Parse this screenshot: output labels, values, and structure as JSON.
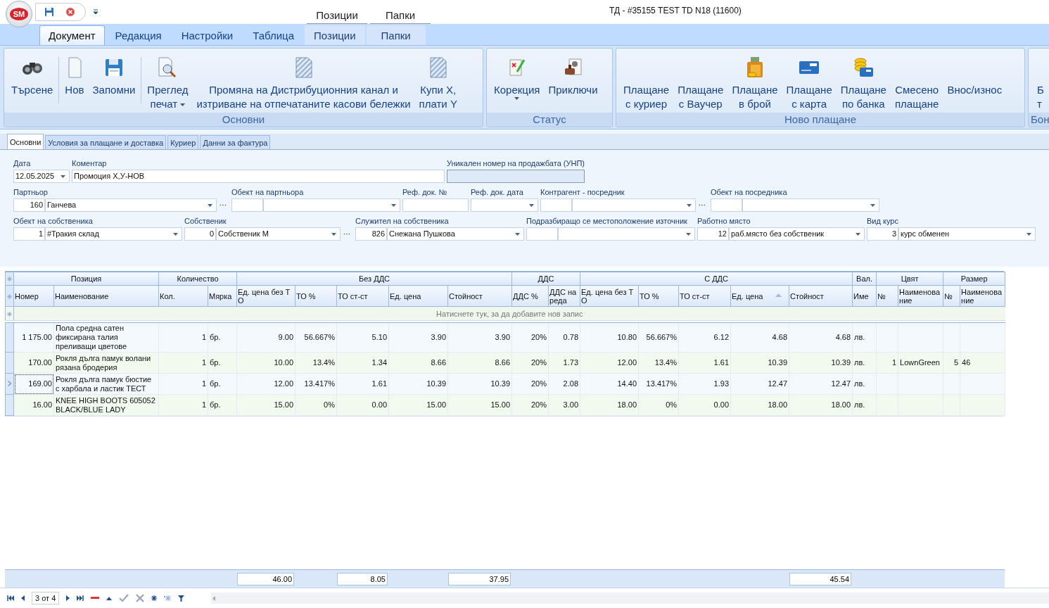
{
  "window": {
    "title": "ТД - #35155 TEST TD N18 (11600)"
  },
  "app_logo": {
    "text": "SM"
  },
  "contextual_groups": [
    {
      "label": "Позиции"
    },
    {
      "label": "Папки"
    }
  ],
  "ribbon_tabs": [
    {
      "label": "Документ",
      "selected": true,
      "contextual": false
    },
    {
      "label": "Редакция",
      "selected": false,
      "contextual": false
    },
    {
      "label": "Настройки",
      "selected": false,
      "contextual": false
    },
    {
      "label": "Таблица",
      "selected": false,
      "contextual": false
    },
    {
      "label": "Позиции",
      "selected": false,
      "contextual": true
    },
    {
      "label": "Папки",
      "selected": false,
      "contextual": true
    }
  ],
  "ribbon_groups": [
    {
      "label": "Основни",
      "buttons": [
        {
          "label": "Търсене",
          "dropdown": false
        },
        {
          "label": "Нов",
          "dropdown": false
        },
        {
          "label": "Запомни",
          "dropdown": false
        },
        {
          "label": "Преглед\nпечат",
          "dropdown": true
        },
        {
          "label": "Промяна на Дистрибуционния канал и\nизтриване на отпечатаните касови бележки",
          "dropdown": false
        },
        {
          "label": "Купи Х,\nплати Y",
          "dropdown": false
        }
      ]
    },
    {
      "label": "Статус",
      "buttons": [
        {
          "label": "Корекция",
          "dropdown": true
        },
        {
          "label": "Приключи",
          "dropdown": false
        }
      ]
    },
    {
      "label": "Ново плащане",
      "buttons": [
        {
          "label": "Плащане\nс куриер",
          "dropdown": false
        },
        {
          "label": "Плащане\nс Ваучер",
          "dropdown": false
        },
        {
          "label": "Плащане\nв брой",
          "dropdown": false
        },
        {
          "label": "Плащане\nс карта",
          "dropdown": false
        },
        {
          "label": "Плащане\nпо банка",
          "dropdown": false
        },
        {
          "label": "Смесено\nплащане",
          "dropdown": false
        },
        {
          "label": "Внос/износ",
          "dropdown": false
        }
      ]
    },
    {
      "label": "Бон",
      "buttons": [
        {
          "label": "Б\nт",
          "dropdown": false
        }
      ]
    }
  ],
  "form_tabs": [
    {
      "label": "Основни",
      "selected": true
    },
    {
      "label": "Условия за плащане и доставка",
      "selected": false
    },
    {
      "label": "Куриер",
      "selected": false
    },
    {
      "label": "Данни за фактура",
      "selected": false
    }
  ],
  "form_rows": [
    {
      "fields": [
        {
          "label": "Дата",
          "kind": "date",
          "value": "12.05.2025"
        },
        {
          "label": "Коментар",
          "kind": "text",
          "value": "Промоция Х,У-НОВ"
        },
        {
          "label": "Уникален номер на продажбата (УНП)",
          "kind": "readonly"
        }
      ]
    },
    {
      "fields": [
        {
          "label": "Партньор",
          "kind": "combo",
          "code": "160",
          "value": "Ганчева",
          "browse": true
        },
        {
          "label": "Обект на партньора",
          "kind": "combo",
          "browse": false
        },
        {
          "label": "Реф. док. №",
          "kind": "text"
        },
        {
          "label": "Реф. док. дата",
          "kind": "date"
        },
        {
          "label": "Контрагент - посредник",
          "kind": "combo",
          "browse": true
        },
        {
          "label": "Обект на посредника",
          "kind": "combo",
          "browse": false
        }
      ]
    },
    {
      "fields": [
        {
          "label": "Обект на собственика",
          "kind": "combo",
          "code": "1",
          "value": "#Тракия склад",
          "browse": false
        },
        {
          "label": "Собственик",
          "kind": "combo",
          "code": "0",
          "value": "Собственик М",
          "browse": true
        },
        {
          "label": "Служител на собственика",
          "kind": "combo",
          "code": "826",
          "value": "Снежана Пушкова",
          "browse": false
        },
        {
          "label": "Подразбиращо се местоположение източник",
          "kind": "combo",
          "browse": false
        },
        {
          "label": "Работно място",
          "kind": "combo",
          "code": "12",
          "value": "раб.място без собственик",
          "browse": false
        },
        {
          "label": "Вид курс",
          "kind": "combo",
          "code": "3",
          "value": "курс обменен",
          "browse": false
        }
      ]
    }
  ],
  "grid": {
    "column_groups": [
      {
        "label": "Позиция",
        "columns": [
          {
            "label": "Номер",
            "numeric": true
          },
          {
            "label": "Наименование",
            "numeric": false
          }
        ]
      },
      {
        "label": "Количество",
        "columns": [
          {
            "label": "Кол.",
            "numeric": true
          },
          {
            "label": "Мярка",
            "numeric": false
          }
        ]
      },
      {
        "label": "Без ДДС",
        "columns": [
          {
            "label": "Ед. цена без ТО",
            "numeric": true,
            "total": "46.00"
          },
          {
            "label": "ТО %",
            "numeric": true
          },
          {
            "label": "ТО ст-ст",
            "numeric": true,
            "total": "8.05"
          },
          {
            "label": "Ед. цена",
            "numeric": true
          },
          {
            "label": "Стойност",
            "numeric": true,
            "total": "37.95"
          }
        ]
      },
      {
        "label": "ДДС",
        "columns": [
          {
            "label": "ДДС %",
            "numeric": true
          },
          {
            "label": "ДДС на реда",
            "numeric": true
          }
        ]
      },
      {
        "label": "С ДДС",
        "columns": [
          {
            "label": "Ед. цена без ТО",
            "numeric": true
          },
          {
            "label": "ТО %",
            "numeric": true
          },
          {
            "label": "ТО ст-ст",
            "numeric": true
          },
          {
            "label": "Ед. цена",
            "numeric": true,
            "sorted_ascending": true
          },
          {
            "label": "Стойност",
            "numeric": true,
            "total": "45.54"
          }
        ]
      },
      {
        "label": "Вал.",
        "columns": [
          {
            "label": "Име",
            "numeric": false
          }
        ]
      },
      {
        "label": "Цвят",
        "columns": [
          {
            "label": "№",
            "numeric": true
          },
          {
            "label": "Наименование",
            "numeric": false
          }
        ]
      },
      {
        "label": "Размер",
        "columns": [
          {
            "label": "№",
            "numeric": true
          },
          {
            "label": "Наименование",
            "numeric": false
          }
        ]
      }
    ],
    "new_row_prompt": "Натиснете тук, за да добавите нов запис",
    "rows": [
      {
        "selected": false,
        "cells": [
          "1 175.00",
          "Пола средна сатен фиксирана талия преливащи цветове",
          "1",
          "бр.",
          "9.00",
          "56.667%",
          "5.10",
          "3.90",
          "3.90",
          "20%",
          "0.78",
          "10.80",
          "56.667%",
          "6.12",
          "4.68",
          "4.68",
          "лв.",
          null,
          null,
          null,
          null
        ]
      },
      {
        "selected": false,
        "cells": [
          "170.00",
          "Рокля дълга памук волани рязана бродерия",
          "1",
          "бр.",
          "10.00",
          "13.4%",
          "1.34",
          "8.66",
          "8.66",
          "20%",
          "1.73",
          "12.00",
          "13.4%",
          "1.61",
          "10.39",
          "10.39",
          "лв.",
          "1",
          "LownGreen",
          "5",
          "46"
        ]
      },
      {
        "selected": true,
        "cells": [
          "169.00",
          "Рокля дълга памук бюстие с харбала и ластик ТЕСТ",
          "1",
          "бр.",
          "12.00",
          "13.417%",
          "1.61",
          "10.39",
          "10.39",
          "20%",
          "2.08",
          "14.40",
          "13.417%",
          "1.93",
          "12.47",
          "12.47",
          "лв.",
          null,
          null,
          null,
          null
        ]
      },
      {
        "selected": false,
        "cells": [
          "16.00",
          "KNEE HIGH BOOTS 605052 BLACK/BLUE LADY",
          "1",
          "бр.",
          "15.00",
          "0%",
          "0.00",
          "15.00",
          "15.00",
          "20%",
          "3.00",
          "18.00",
          "0%",
          "0.00",
          "18.00",
          "18.00",
          "лв.",
          null,
          null,
          null,
          null
        ]
      }
    ],
    "navigator": {
      "position": "3 от 4"
    }
  }
}
